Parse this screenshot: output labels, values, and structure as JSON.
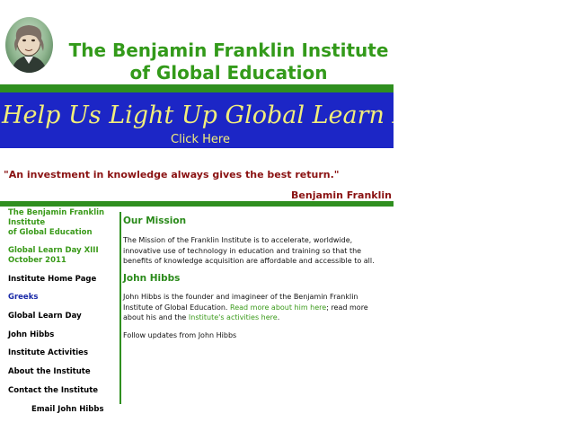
{
  "header": {
    "title_line1": "The Benjamin Franklin Institute",
    "title_line2": "of Global Education",
    "logo": "benjamin-franklin-portrait"
  },
  "banner": {
    "headline": "Help Us Light Up Global Learn Day",
    "cta": "Click Here",
    "background": "#1c26c6",
    "text_color": "#f2ee7a"
  },
  "quote": {
    "text": "\"An investment in knowledge always gives the best return.\"",
    "author": "Benjamin Franklin"
  },
  "sidebar": {
    "org_line1": "The Benjamin Franklin",
    "org_line2": "Institute",
    "org_line3": "of Global Education",
    "event_line1": "Global Learn Day XIII",
    "event_line2": "October 2011",
    "links": [
      "Institute Home Page",
      "Greeks",
      "Global Learn Day",
      "John Hibbs",
      "Institute Activities",
      "About the Institute",
      "Contact the Institute",
      "Email John Hibbs"
    ]
  },
  "mission": {
    "heading": "Our Mission",
    "body": "The Mission of the Franklin Institute is to accelerate, worldwide, innovative use of technology in education and training so that the benefits of knowledge acquisition are affordable and accessible to all."
  },
  "hibbs": {
    "heading": "John Hibbs",
    "body_start": "John Hibbs is the founder and imagineer of the Benjamin Franklin Institute of Global Education. ",
    "link1": "Read more about him here",
    "body_mid": "; read more about his and the ",
    "link2": "Institute's activities here",
    "body_end": ".",
    "follow": "Follow updates from John Hibbs"
  },
  "colors": {
    "brand_green": "#339a1a",
    "bar_green": "#2f8f1f",
    "quote_red": "#8a1212",
    "link_blue": "#1a2aa8"
  }
}
